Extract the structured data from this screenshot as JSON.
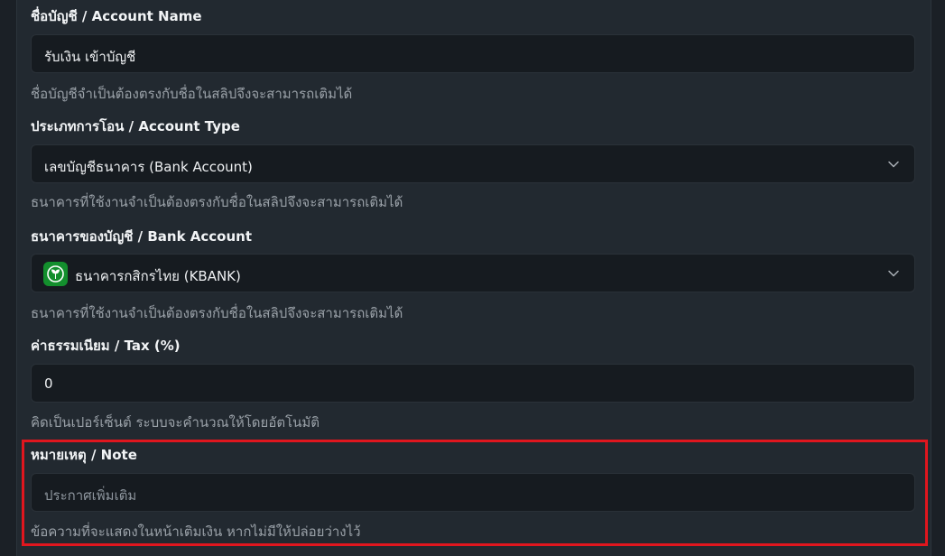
{
  "form": {
    "account_name": {
      "label": "ชื่อบัญชี / Account Name",
      "value": "รับเงิน เข้าบัญชี",
      "help": "ชื่อบัญชีจำเป็นต้องตรงกับชื่อในสลิปจึงจะสามารถเติมได้"
    },
    "account_type": {
      "label": "ประเภทการโอน / Account Type",
      "value": "เลขบัญชีธนาคาร (Bank Account)",
      "help": "ธนาคารที่ใช้งานจำเป็นต้องตรงกับชื่อในสลิปจึงจะสามารถเติมได้"
    },
    "bank_account": {
      "label": "ธนาคารของบัญชี / Bank Account",
      "value": "ธนาคารกสิกรไทย (KBANK)",
      "icon": "kbank-logo-icon",
      "help": "ธนาคารที่ใช้งานจำเป็นต้องตรงกับชื่อในสลิปจึงจะสามารถเติมได้"
    },
    "tax": {
      "label": "ค่าธรรมเนียม / Tax (%)",
      "value": "0",
      "help": "คิดเป็นเปอร์เซ็นต์ ระบบจะคำนวณให้โดยอัตโนมัติ"
    },
    "note": {
      "label": "หมายเหตุ / Note",
      "placeholder": "ประกาศเพิ่มเติม",
      "help": "ข้อความที่จะแสดงในหน้าเติมเงิน หากไม่มีให้ปล่อยว่างไว้"
    }
  },
  "colors": {
    "background": "#222930",
    "input_bg": "#161b20",
    "highlight": "#e0161e",
    "kbank_green": "#138f2d"
  }
}
